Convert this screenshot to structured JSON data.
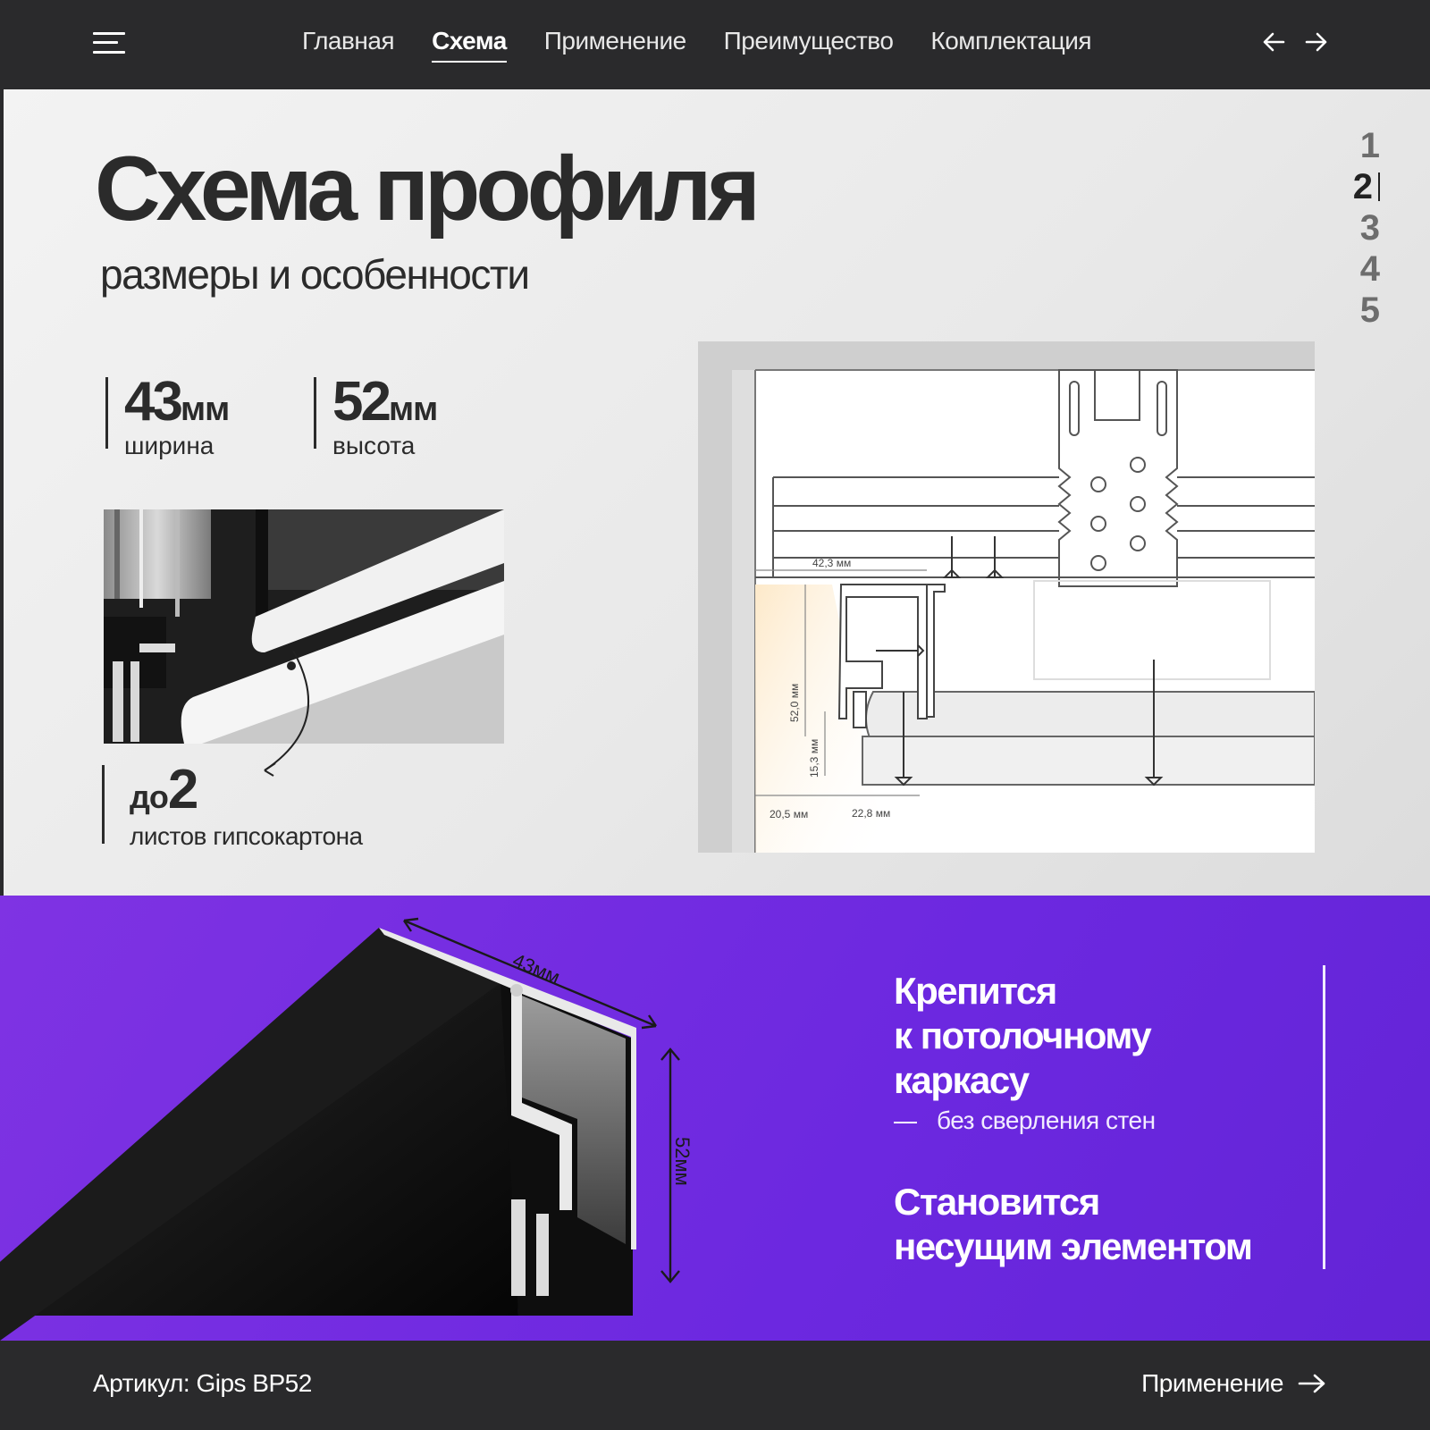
{
  "nav": {
    "items": [
      {
        "label": "Главная",
        "active": false
      },
      {
        "label": "Схема",
        "active": true
      },
      {
        "label": "Применение",
        "active": false
      },
      {
        "label": "Преимущество",
        "active": false
      },
      {
        "label": "Комплектация",
        "active": false
      }
    ],
    "icons": {
      "menu": "hamburger-icon",
      "prev": "arrow-left-icon",
      "next": "arrow-right-icon"
    }
  },
  "hero": {
    "title": "Схема профиля",
    "subtitle": "размеры и особенности"
  },
  "pager": [
    "1",
    "2",
    "3",
    "4",
    "5"
  ],
  "pager_active": "2",
  "stats": {
    "width": {
      "value": "43",
      "unit": "мм",
      "label": "ширина"
    },
    "height": {
      "value": "52",
      "unit": "мм",
      "label": "высота"
    },
    "sheets": {
      "prefix": "до",
      "value": "2",
      "label": "листов гипсокартона"
    }
  },
  "drawing": {
    "dim_top": "42,3 мм",
    "dim_height": "52,0 мм",
    "dim_lower": "15,3 мм",
    "dim_left": "20,5 мм",
    "dim_right": "22,8 мм"
  },
  "profile_dims": {
    "width": "43мм",
    "height": "52мм"
  },
  "features": {
    "first_lines": [
      "Крепится",
      "к потолочному",
      "каркасу"
    ],
    "first_sub": "без сверления стен",
    "second_lines": [
      "Становится",
      "несущим элементом"
    ]
  },
  "footer": {
    "sku": "Артикул: Gips BP52",
    "next_label": "Применение"
  },
  "colors": {
    "dark": "#2a2a2c",
    "purple": "#7530e2",
    "text": "#2b2b2b"
  }
}
